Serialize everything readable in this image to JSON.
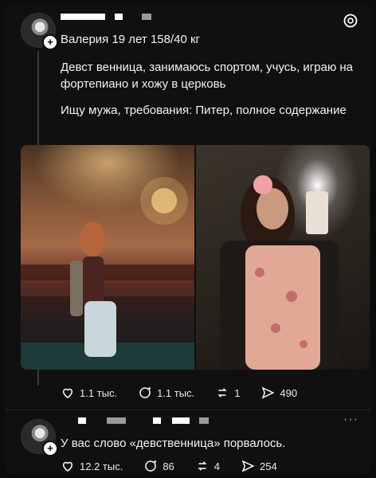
{
  "post1": {
    "header": "Валерия 19 лет 158/40 кг",
    "paragraph1": "Девст  венница, занимаюсь спортом, учусь, играю на фортепиано и хожу в церковь",
    "paragraph2": "Ищу мужа, требования: Питер, полное содержание",
    "likes": "1.1 тыс.",
    "comments": "1.1 тыс.",
    "reposts": "1",
    "shares": "490"
  },
  "post2": {
    "text": "У вас слово «девственница» порвалось.",
    "likes": "12.2 тыс.",
    "comments": "86",
    "reposts": "4",
    "shares": "254",
    "more": "···"
  },
  "icons": {
    "brand": "threads-icon",
    "like": "heart-icon",
    "comment": "comment-icon",
    "repost": "repost-icon",
    "share": "send-icon"
  }
}
